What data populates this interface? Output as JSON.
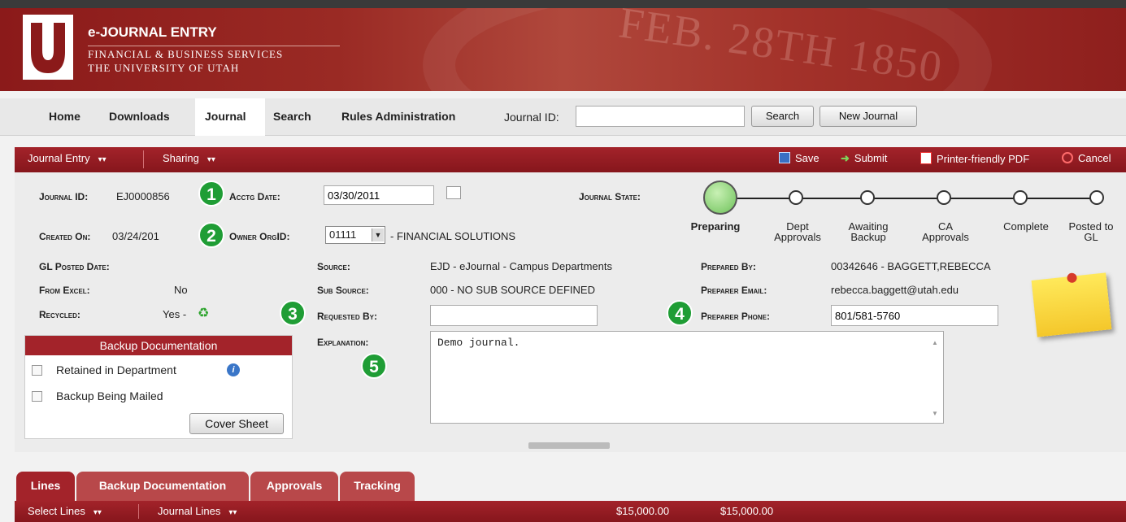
{
  "app": {
    "title": "e-JOURNAL ENTRY",
    "subtitle1": "FINANCIAL & BUSINESS SERVICES",
    "subtitle2": "THE UNIVERSITY OF UTAH",
    "seal_text": "FEB. 28TH 1850"
  },
  "nav": {
    "items": [
      "Home",
      "Downloads",
      "Journal",
      "Search",
      "Rules Administration"
    ],
    "journal_id_label": "Journal ID:",
    "journal_id_value": "",
    "search_button": "Search",
    "new_journal_button": "New Journal"
  },
  "toolbar": {
    "journal_entry": "Journal Entry",
    "sharing": "Sharing",
    "save": "Save",
    "submit": "Submit",
    "printer_pdf": "Printer-friendly PDF",
    "cancel": "Cancel"
  },
  "header_fields": {
    "journal_id_label": "Journal ID:",
    "journal_id_value": "EJ0000856",
    "acctg_date_label": "Acctg Date:",
    "acctg_date_value": "03/30/2011",
    "created_on_label": "Created On:",
    "created_on_value": "03/24/201",
    "owner_orgid_label": "Owner OrgID:",
    "owner_orgid_value": "01111",
    "owner_org_name": "- FINANCIAL SOLUTIONS",
    "journal_state_label": "Journal State:"
  },
  "journal_state": {
    "current": "Preparing",
    "steps": [
      {
        "label": "Preparing",
        "l2": ""
      },
      {
        "label": "Dept",
        "l2": "Approvals"
      },
      {
        "label": "Awaiting",
        "l2": "Backup"
      },
      {
        "label": "CA",
        "l2": "Approvals"
      },
      {
        "label": "Complete",
        "l2": ""
      },
      {
        "label": "Posted to",
        "l2": "GL"
      }
    ]
  },
  "details": {
    "gl_posted_date_label": "GL Posted Date:",
    "gl_posted_date_value": "",
    "from_excel_label": "From Excel:",
    "from_excel_value": "No",
    "recycled_label": "Recycled:",
    "recycled_value": "Yes -",
    "source_label": "Source:",
    "source_value": "EJD - eJournal - Campus Departments",
    "sub_source_label": "Sub Source:",
    "sub_source_value": "000 - NO SUB SOURCE DEFINED",
    "requested_by_label": "Requested By:",
    "requested_by_value": "",
    "explanation_label": "Explanation:",
    "explanation_value": "Demo journal.",
    "prepared_by_label": "Prepared By:",
    "prepared_by_value": "00342646 - BAGGETT,REBECCA",
    "preparer_email_label": "Preparer Email:",
    "preparer_email_value": "rebecca.baggett@utah.edu",
    "preparer_phone_label": "Preparer Phone:",
    "preparer_phone_value": "801/581-5760"
  },
  "markers": [
    "1",
    "2",
    "3",
    "4",
    "5"
  ],
  "backup": {
    "title": "Backup Documentation",
    "retained_label": "Retained in Department",
    "mailed_label": "Backup Being Mailed",
    "cover_sheet_button": "Cover Sheet"
  },
  "tabs": [
    "Lines",
    "Backup Documentation",
    "Approvals",
    "Tracking"
  ],
  "lines_bar": {
    "select_lines": "Select Lines",
    "journal_lines": "Journal Lines",
    "debit_total": "$15,000.00",
    "credit_total": "$15,000.00"
  },
  "colors": {
    "brand_red": "#a3232a",
    "marker_green": "#1f9d35",
    "tab_inactive": "#b8484a"
  }
}
